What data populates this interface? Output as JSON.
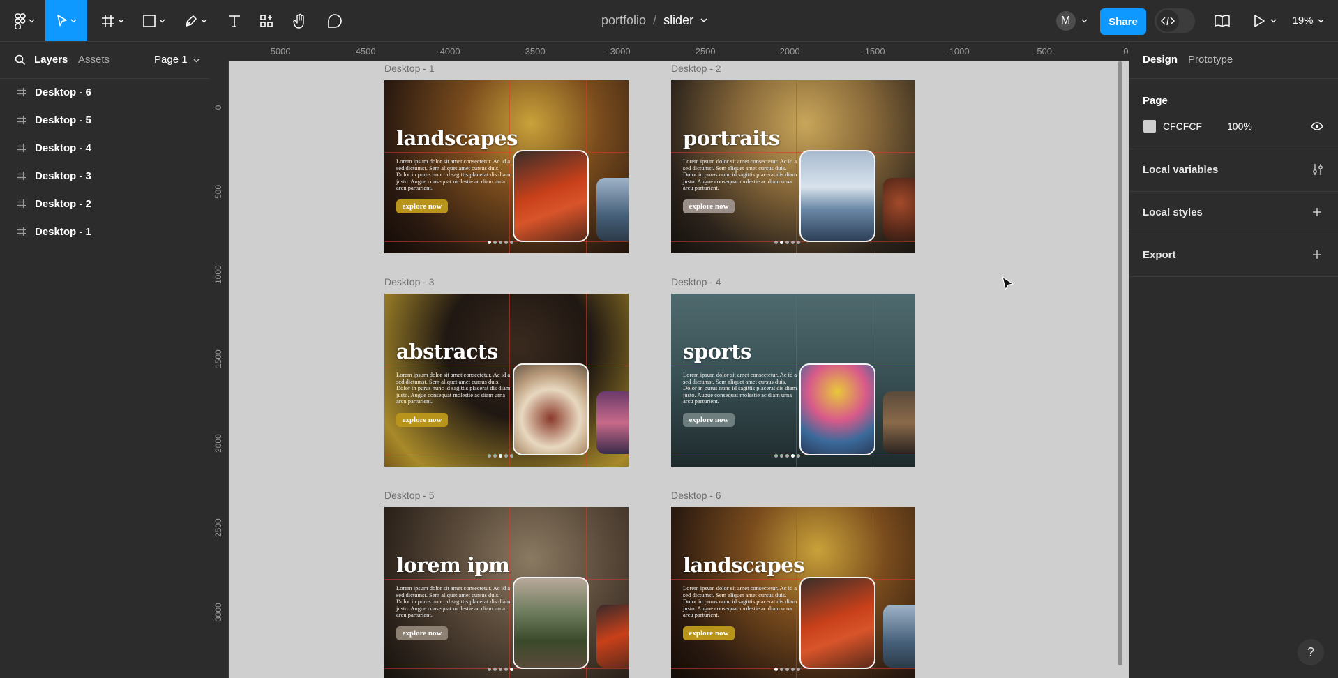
{
  "toolbar": {
    "project": "portfolio",
    "separator": "/",
    "file": "slider",
    "avatar_initial": "M",
    "share_label": "Share",
    "zoom": "19%",
    "icons": [
      "figma-menu-icon",
      "move-tool-icon",
      "frame-tool-icon",
      "shape-tool-icon",
      "pen-tool-icon",
      "text-tool-icon",
      "components-icon",
      "hand-tool-icon",
      "comment-icon",
      "dev-mode-icon",
      "library-icon",
      "present-icon"
    ]
  },
  "left_panel": {
    "tab_layers": "Layers",
    "tab_assets": "Assets",
    "page_selector": "Page 1",
    "layers": [
      "Desktop - 6",
      "Desktop - 5",
      "Desktop - 4",
      "Desktop - 3",
      "Desktop - 2",
      "Desktop - 1"
    ]
  },
  "rulers": {
    "x": [
      "-5000",
      "-4500",
      "-4000",
      "-3500",
      "-3000",
      "-2500",
      "-2000",
      "-1500",
      "-1000",
      "-500",
      "0"
    ],
    "y": [
      "0",
      "500",
      "1000",
      "1500",
      "2000",
      "2500",
      "3000"
    ]
  },
  "canvas": {
    "background": "#CFCFCF",
    "body_text": "Lorem ipsum dolor sit amet consectetur. Ac id a sed dictumst. Sem aliquet amet cursus duis. Dolor in purus nunc id sagittis placerat dis diam justo. Augue consequat molestie ac diam urna arcu parturient.",
    "button_label": "explore now",
    "frames": [
      {
        "label": "Desktop - 1",
        "title": "landscapes",
        "accent": "#b8951a",
        "active_dot": 0
      },
      {
        "label": "Desktop - 2",
        "title": "portraits",
        "accent": "#9a8f88",
        "active_dot": 1
      },
      {
        "label": "Desktop - 3",
        "title": "abstracts",
        "accent": "#b8951a",
        "active_dot": 2
      },
      {
        "label": "Desktop - 4",
        "title": "sports",
        "accent": "#6e7d7d",
        "active_dot": 3
      },
      {
        "label": "Desktop - 5",
        "title": "lorem ipm",
        "accent": "#8b8072",
        "active_dot": 4
      },
      {
        "label": "Desktop - 6",
        "title": "landscapes",
        "accent": "#b8951a",
        "active_dot": 0
      }
    ]
  },
  "right_panel": {
    "tab_design": "Design",
    "tab_prototype": "Prototype",
    "page_heading": "Page",
    "page_color": "CFCFCF",
    "page_opacity": "100%",
    "local_variables": "Local variables",
    "local_styles": "Local styles",
    "export": "Export"
  },
  "help": "?"
}
